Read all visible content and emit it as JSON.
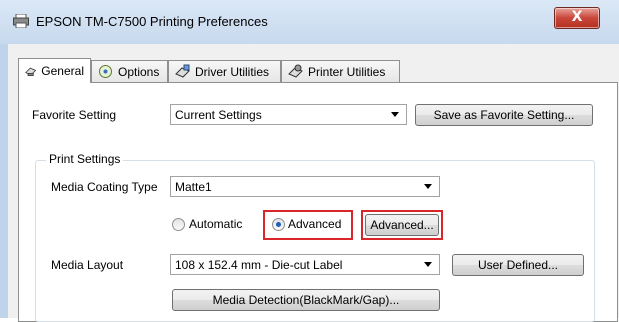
{
  "window": {
    "title": "EPSON TM-C7500 Printing Preferences",
    "close_glyph": "X"
  },
  "tabs": [
    {
      "label": "General",
      "icon": "general-tab-icon"
    },
    {
      "label": "Options",
      "icon": "options-tab-icon"
    },
    {
      "label": "Driver Utilities",
      "icon": "driver-utilities-tab-icon"
    },
    {
      "label": "Printer Utilities",
      "icon": "printer-utilities-tab-icon"
    }
  ],
  "favorite": {
    "label": "Favorite Setting",
    "value": "Current Settings",
    "save_button": "Save as Favorite Setting..."
  },
  "print_settings": {
    "group_title": "Print Settings",
    "media_coating_label": "Media Coating Type",
    "media_coating_value": "Matte1",
    "automatic_label": "Automatic",
    "advanced_radio_label": "Advanced",
    "advanced_button": "Advanced...",
    "media_layout_label": "Media Layout",
    "media_layout_value": "108 x 152.4 mm - Die-cut Label",
    "user_defined_button": "User Defined...",
    "media_detection_button": "Media Detection(BlackMark/Gap)..."
  },
  "colors": {
    "highlight": "#d9262a",
    "titlebar": "#c7d9ee",
    "close": "#c9463a"
  }
}
